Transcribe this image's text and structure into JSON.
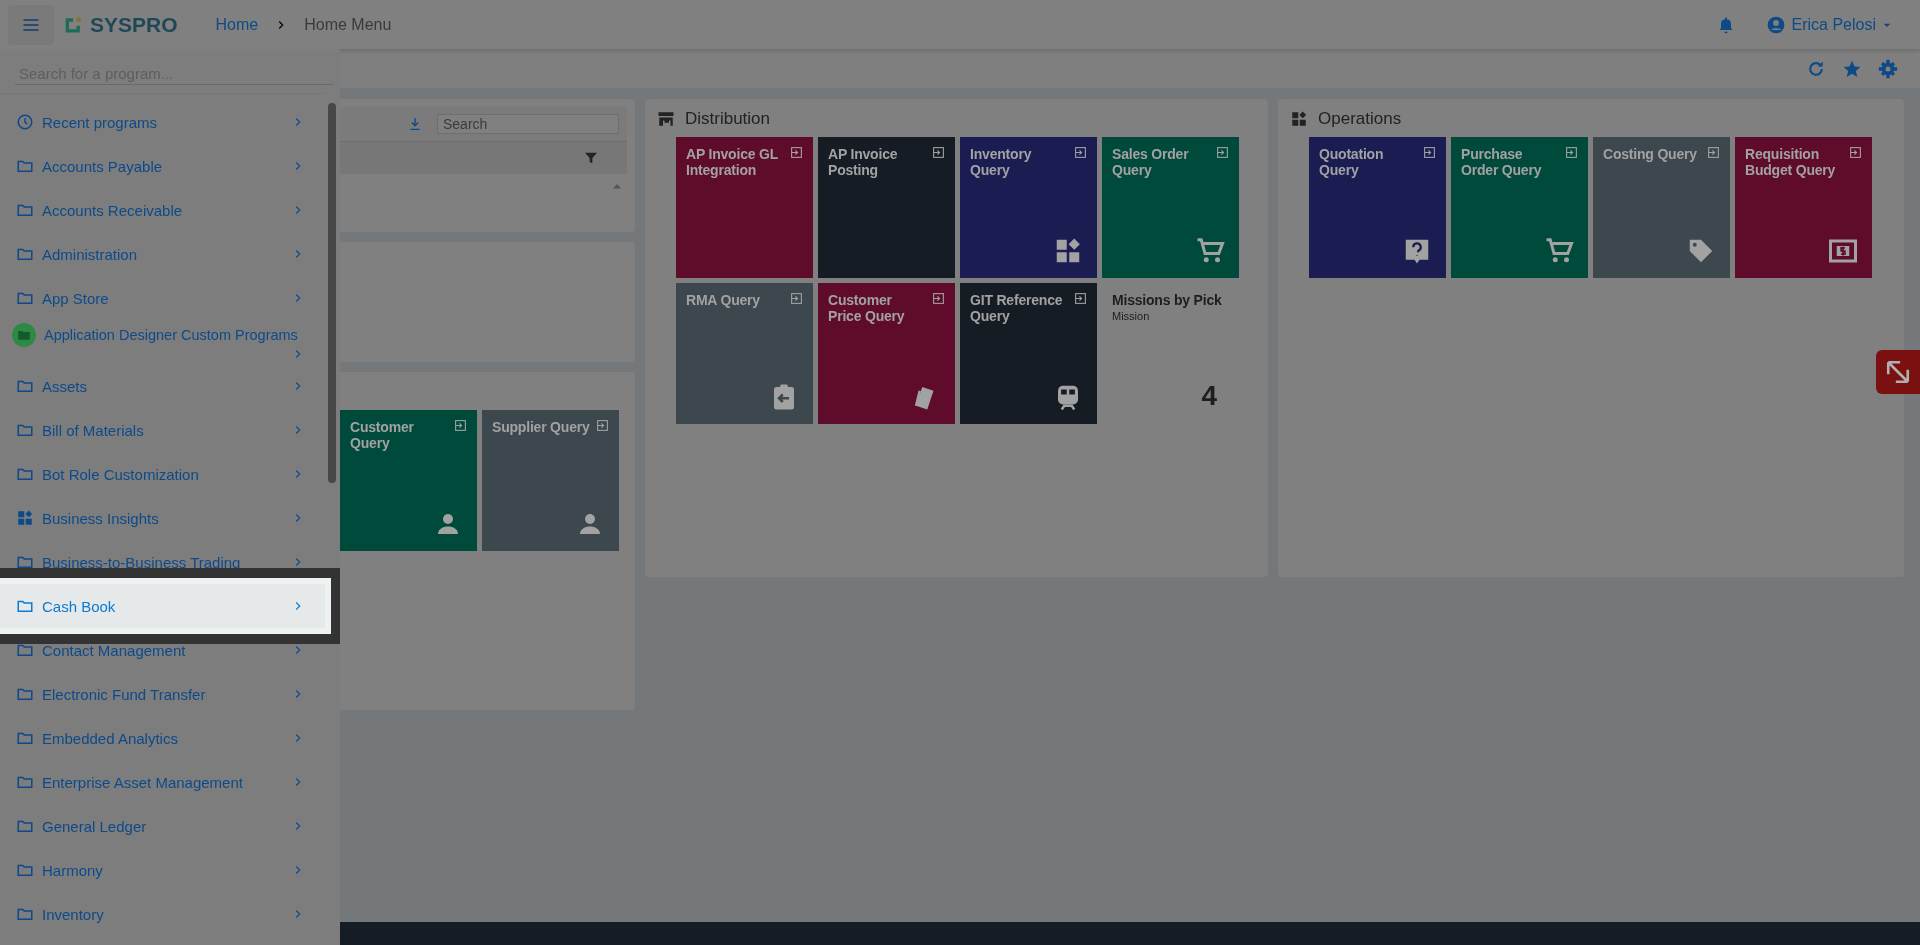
{
  "top_bar": {
    "brand": "SYSPRO",
    "breadcrumb": [
      {
        "label": "Home",
        "kind": "link"
      },
      {
        "label": "Home Menu",
        "kind": "current"
      }
    ],
    "user": "Erica Pelosi"
  },
  "sidebar": {
    "search": {
      "placeholder": "Search for a program..."
    },
    "items": [
      {
        "label": "Recent programs",
        "kind": "recent",
        "selected": false
      },
      {
        "label": "Accounts Payable",
        "kind": "folder",
        "selected": false
      },
      {
        "label": "Accounts Receivable",
        "kind": "folder",
        "selected": false
      },
      {
        "label": "Administration",
        "kind": "folder",
        "selected": false
      },
      {
        "label": "App Store",
        "kind": "folder",
        "selected": false
      },
      {
        "label": "Application Designer Custom Programs",
        "kind": "custom",
        "selected": false
      },
      {
        "label": "Assets",
        "kind": "folder",
        "selected": false
      },
      {
        "label": "Bill of Materials",
        "kind": "folder",
        "selected": false
      },
      {
        "label": "Bot Role Customization",
        "kind": "folder",
        "selected": false
      },
      {
        "label": "Business Insights",
        "kind": "insights",
        "selected": false
      },
      {
        "label": "Business-to-Business Trading",
        "kind": "folder",
        "selected": false
      },
      {
        "label": "Cash Book",
        "kind": "folder",
        "selected": true
      },
      {
        "label": "Contact Management",
        "kind": "folder",
        "selected": false
      },
      {
        "label": "Electronic Fund Transfer",
        "kind": "folder",
        "selected": false
      },
      {
        "label": "Embedded Analytics",
        "kind": "folder",
        "selected": false
      },
      {
        "label": "Enterprise Asset Management",
        "kind": "folder",
        "selected": false
      },
      {
        "label": "General Ledger",
        "kind": "folder",
        "selected": false
      },
      {
        "label": "Harmony",
        "kind": "folder",
        "selected": false
      },
      {
        "label": "Inventory",
        "kind": "folder",
        "selected": false
      }
    ]
  },
  "left_panels": {
    "table_search": {
      "placeholder": "Search"
    },
    "tiles": [
      {
        "title": "Customer Query",
        "kind": "launch",
        "color": "#004a3c"
      },
      {
        "title": "Supplier Query",
        "kind": "launch",
        "color": "#3c474e"
      }
    ]
  },
  "panels": [
    {
      "title": "Distribution",
      "tiles": [
        {
          "title": "AP Invoice GL Integration",
          "kind": "launch",
          "color": "#5f0b2c"
        },
        {
          "title": "AP Invoice Posting",
          "kind": "launch",
          "color": "#161c24"
        },
        {
          "title": "Inventory Query",
          "kind": "launch",
          "color": "#1a1c52"
        },
        {
          "title": "Sales Order Query",
          "kind": "launch",
          "color": "#004a3c"
        },
        {
          "title": "RMA Query",
          "kind": "launch",
          "color": "#3c474e"
        },
        {
          "title": "Customer Price Query",
          "kind": "launch",
          "color": "#5f0b2c"
        },
        {
          "title": "GIT Reference Query",
          "kind": "launch",
          "color": "#161c24"
        },
        {
          "title": "Missions by Pick",
          "kind": "count",
          "subtitle": "Mission",
          "value": "4"
        }
      ]
    },
    {
      "title": "Operations",
      "tiles": [
        {
          "title": "Quotation Query",
          "kind": "launch",
          "color": "#1a1c52"
        },
        {
          "title": "Purchase Order Query",
          "kind": "launch",
          "color": "#004a3c"
        },
        {
          "title": "Costing Query",
          "kind": "launch",
          "color": "#3c474e"
        },
        {
          "title": "Requisition Budget Query",
          "kind": "launch",
          "color": "#5f0b2c"
        }
      ]
    }
  ]
}
